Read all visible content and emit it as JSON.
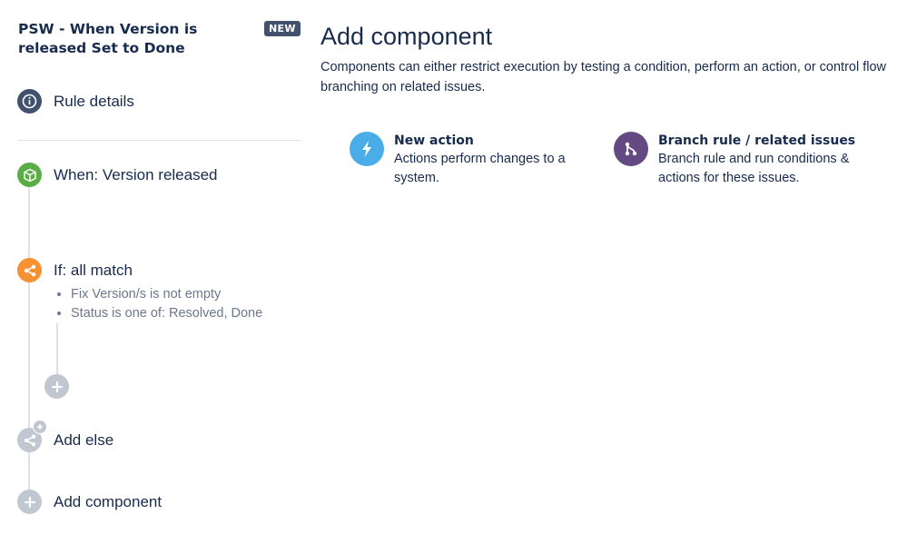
{
  "sidebar": {
    "rule_title": "PSW - When Version is released Set to Done",
    "badge": "NEW",
    "rule_details_label": "Rule details",
    "trigger_label": "When: Version released",
    "condition_label": "If: all match",
    "conditions": [
      "Fix Version/s is not empty",
      "Status is one of: Resolved, Done"
    ],
    "add_else_label": "Add else",
    "add_component_label": "Add component"
  },
  "main": {
    "title": "Add component",
    "description": "Components can either restrict execution by testing a condition, perform an action, or control flow branching on related issues.",
    "cards": [
      {
        "title": "New action",
        "description": "Actions perform changes to a system.",
        "icon": "lightning-icon"
      },
      {
        "title": "Branch rule / related issues",
        "description": "Branch rule and run conditions & actions for these issues.",
        "icon": "branch-icon"
      }
    ]
  },
  "colors": {
    "rule_details": "#42526e",
    "trigger": "#5aac44",
    "condition": "#f79232",
    "disabled": "#c1c7d0",
    "action": "#4bade8",
    "branch": "#654982"
  }
}
